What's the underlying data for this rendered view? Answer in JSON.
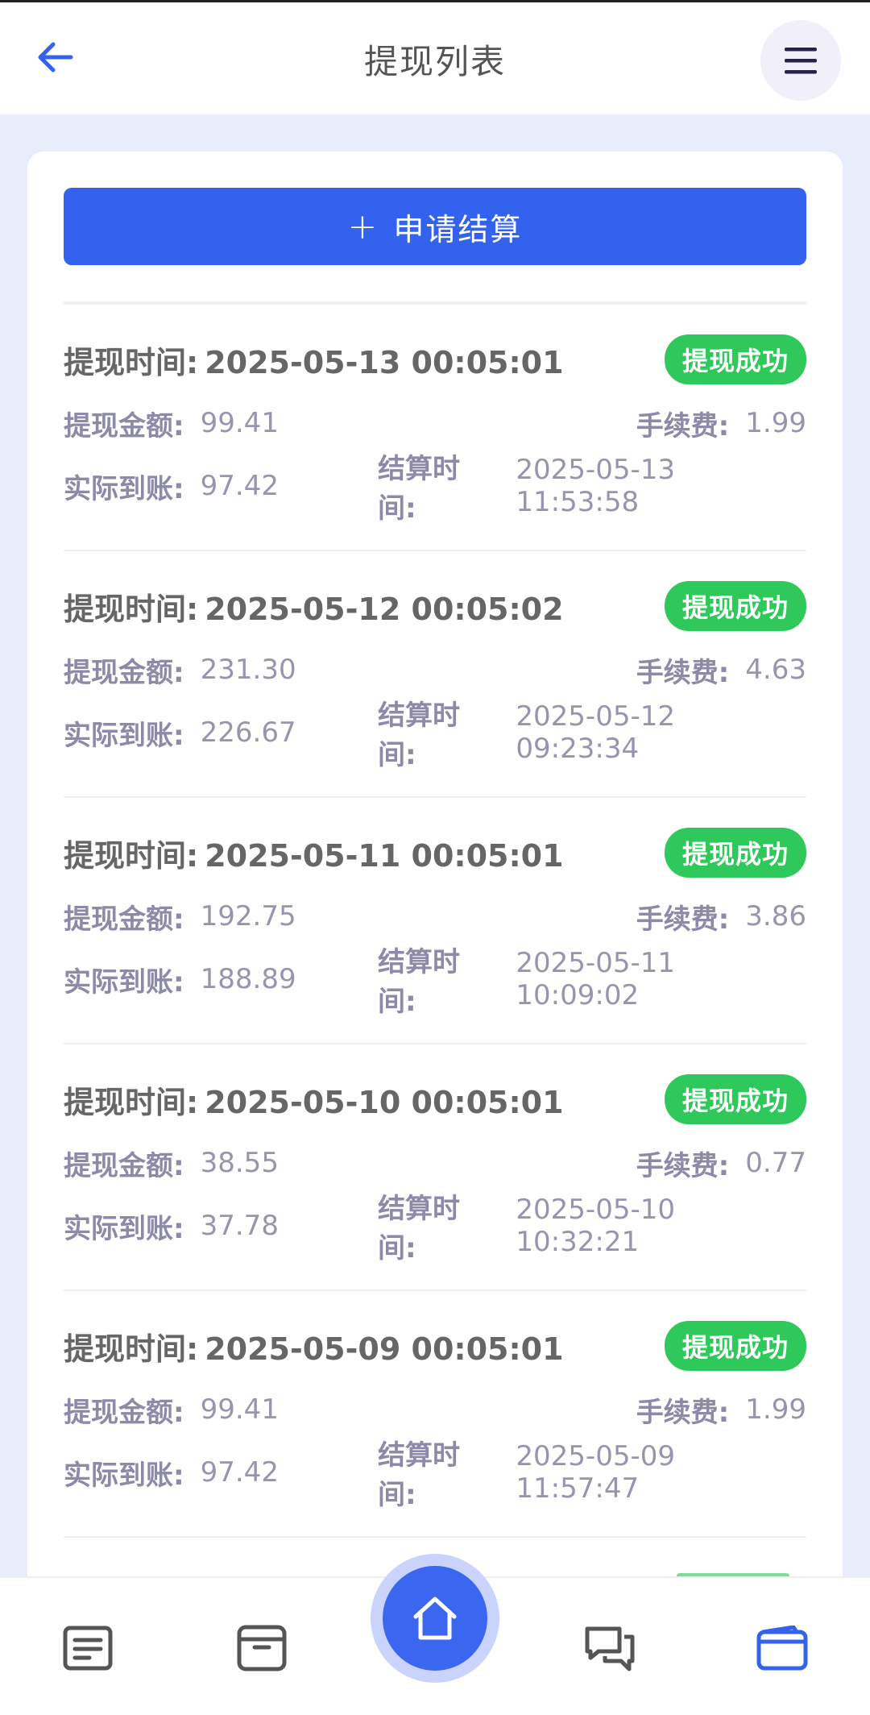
{
  "header": {
    "title": "提现列表",
    "back_icon": "arrow-left-icon",
    "menu_icon": "hamburger-menu-icon"
  },
  "actions": {
    "apply_plus": "+",
    "apply_label": "申请结算"
  },
  "labels": {
    "withdraw_time": "提现时间:",
    "amount": "提现金额:",
    "fee": "手续费:",
    "actual": "实际到账:",
    "settle_time": "结算时间:"
  },
  "records": [
    {
      "withdraw_time": "2025-05-13 00:05:01",
      "status": "提现成功",
      "amount": "99.41",
      "fee": "1.99",
      "actual": "97.42",
      "settle_time": "2025-05-13 11:53:58"
    },
    {
      "withdraw_time": "2025-05-12 00:05:02",
      "status": "提现成功",
      "amount": "231.30",
      "fee": "4.63",
      "actual": "226.67",
      "settle_time": "2025-05-12 09:23:34"
    },
    {
      "withdraw_time": "2025-05-11 00:05:01",
      "status": "提现成功",
      "amount": "192.75",
      "fee": "3.86",
      "actual": "188.89",
      "settle_time": "2025-05-11 10:09:02"
    },
    {
      "withdraw_time": "2025-05-10 00:05:01",
      "status": "提现成功",
      "amount": "38.55",
      "fee": "0.77",
      "actual": "37.78",
      "settle_time": "2025-05-10 10:32:21"
    },
    {
      "withdraw_time": "2025-05-09 00:05:01",
      "status": "提现成功",
      "amount": "99.41",
      "fee": "1.99",
      "actual": "97.42",
      "settle_time": "2025-05-09 11:57:47"
    }
  ],
  "nav": [
    {
      "icon": "document-list-icon"
    },
    {
      "icon": "archive-box-icon"
    },
    {
      "icon": "home-icon"
    },
    {
      "icon": "chat-icon"
    },
    {
      "icon": "wallet-icon"
    }
  ],
  "colors": {
    "primary": "#3363ee",
    "success": "#2fc85a",
    "label": "#8c8aa8",
    "page_bg": "#e8ecfb"
  }
}
